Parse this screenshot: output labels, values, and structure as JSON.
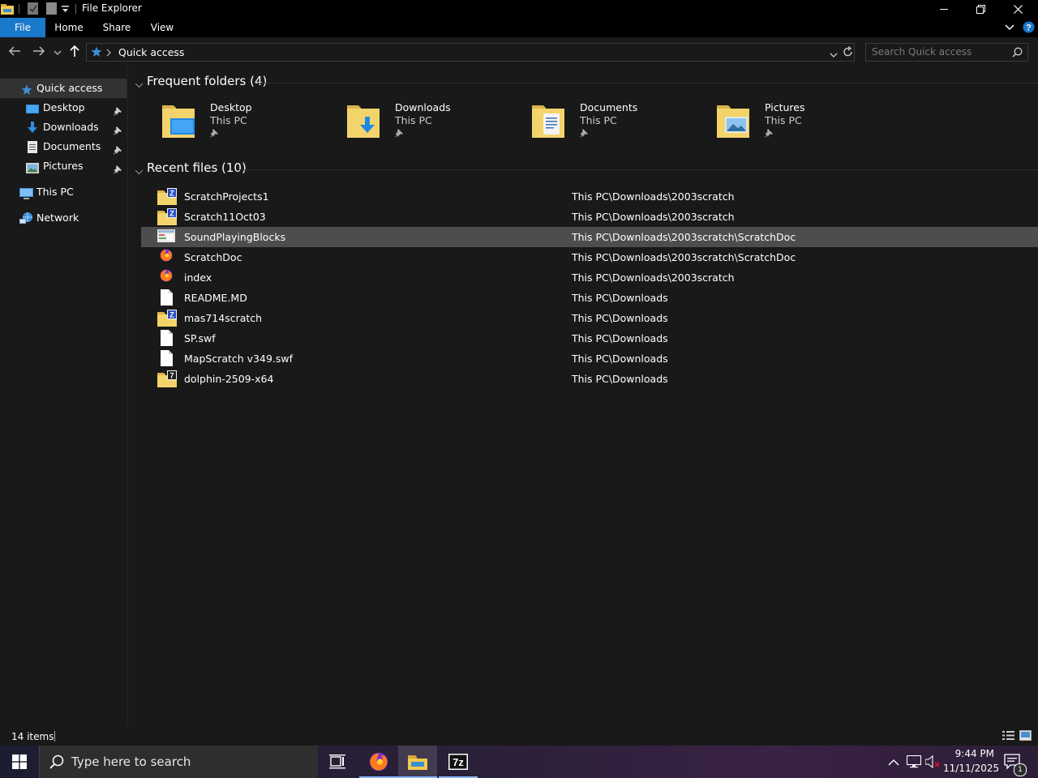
{
  "window": {
    "title": "File Explorer"
  },
  "ribbon": {
    "tabs": [
      "File",
      "Home",
      "Share",
      "View"
    ]
  },
  "address": {
    "path": "Quick access",
    "search_placeholder": "Search Quick access"
  },
  "sidebar": {
    "quick_access": "Quick access",
    "items": [
      {
        "label": "Desktop",
        "icon": "desktop-icon",
        "pinned": true
      },
      {
        "label": "Downloads",
        "icon": "downloads-icon",
        "pinned": true
      },
      {
        "label": "Documents",
        "icon": "documents-icon",
        "pinned": true
      },
      {
        "label": "Pictures",
        "icon": "pictures-icon",
        "pinned": true
      }
    ],
    "this_pc": "This PC",
    "network": "Network"
  },
  "frequent": {
    "heading": "Frequent folders (4)",
    "folders": [
      {
        "name": "Desktop",
        "location": "This PC",
        "icon": "desktop-folder-icon"
      },
      {
        "name": "Downloads",
        "location": "This PC",
        "icon": "downloads-folder-icon"
      },
      {
        "name": "Documents",
        "location": "This PC",
        "icon": "documents-folder-icon"
      },
      {
        "name": "Pictures",
        "location": "This PC",
        "icon": "pictures-folder-icon"
      }
    ]
  },
  "recent": {
    "heading": "Recent files (10)",
    "files": [
      {
        "name": "ScratchProjects1",
        "path": "This PC\\Downloads\\2003scratch",
        "icon": "archive-folder-icon"
      },
      {
        "name": "Scratch11Oct03",
        "path": "This PC\\Downloads\\2003scratch",
        "icon": "archive-folder-icon"
      },
      {
        "name": "SoundPlayingBlocks",
        "path": "This PC\\Downloads\\2003scratch\\ScratchDoc",
        "icon": "image-file-icon",
        "selected": true
      },
      {
        "name": "ScratchDoc",
        "path": "This PC\\Downloads\\2003scratch\\ScratchDoc",
        "icon": "firefox-file-icon"
      },
      {
        "name": "index",
        "path": "This PC\\Downloads\\2003scratch",
        "icon": "firefox-file-icon"
      },
      {
        "name": "README.MD",
        "path": "This PC\\Downloads",
        "icon": "blank-file-icon"
      },
      {
        "name": "mas714scratch",
        "path": "This PC\\Downloads",
        "icon": "archive-folder-icon"
      },
      {
        "name": "SP.swf",
        "path": "This PC\\Downloads",
        "icon": "blank-file-icon"
      },
      {
        "name": "MapScratch v349.swf",
        "path": "This PC\\Downloads",
        "icon": "blank-file-icon"
      },
      {
        "name": "dolphin-2509-x64",
        "path": "This PC\\Downloads",
        "icon": "7z-folder-icon"
      }
    ]
  },
  "status": {
    "items": "14 items"
  },
  "taskbar": {
    "search_placeholder": "Type here to search",
    "time": "9:44 PM",
    "date": "11/11/2025",
    "notification_count": "1"
  },
  "colors": {
    "accent": "#1979ca",
    "selection": "#4d4d4d",
    "folder": "#f3d46b"
  }
}
